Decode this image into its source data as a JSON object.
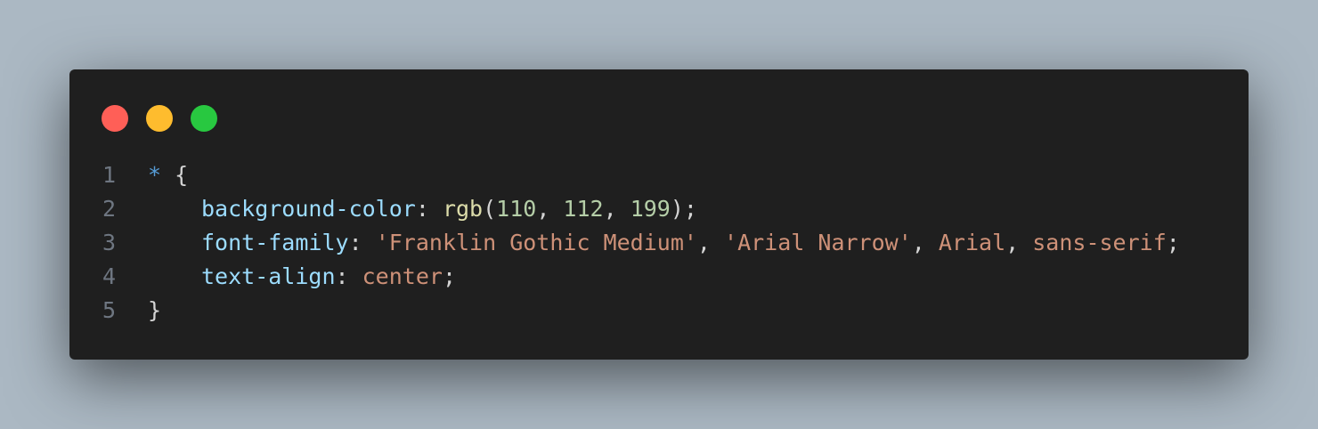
{
  "colors": {
    "background": "#abb8c3",
    "window": "#1f1f1f",
    "close": "#ff5f57",
    "minimize": "#febc2e",
    "zoom": "#28c840",
    "line_number": "#6e7681",
    "selector": "#569cd6",
    "punctuation": "#d4d4d4",
    "property": "#9cdcfe",
    "function": "#dcdcaa",
    "number": "#b5cea8",
    "string": "#ce9178"
  },
  "window_controls": {
    "close_icon": "close-dot",
    "minimize_icon": "minimize-dot",
    "zoom_icon": "zoom-dot"
  },
  "code": {
    "lines": [
      {
        "number": "1",
        "tokens": [
          {
            "text": "*",
            "kind": "selector"
          },
          {
            "text": " {",
            "kind": "punctuation"
          }
        ]
      },
      {
        "number": "2",
        "indent": true,
        "tokens": [
          {
            "text": "background-color",
            "kind": "property"
          },
          {
            "text": ": ",
            "kind": "punctuation"
          },
          {
            "text": "rgb",
            "kind": "function"
          },
          {
            "text": "(",
            "kind": "punctuation"
          },
          {
            "text": "110",
            "kind": "number"
          },
          {
            "text": ", ",
            "kind": "punctuation"
          },
          {
            "text": "112",
            "kind": "number"
          },
          {
            "text": ", ",
            "kind": "punctuation"
          },
          {
            "text": "199",
            "kind": "number"
          },
          {
            "text": ");",
            "kind": "punctuation"
          }
        ]
      },
      {
        "number": "3",
        "indent": true,
        "tokens": [
          {
            "text": "font-family",
            "kind": "property"
          },
          {
            "text": ": ",
            "kind": "punctuation"
          },
          {
            "text": "'Franklin Gothic Medium'",
            "kind": "string"
          },
          {
            "text": ", ",
            "kind": "punctuation"
          },
          {
            "text": "'Arial Narrow'",
            "kind": "string"
          },
          {
            "text": ", ",
            "kind": "punctuation"
          },
          {
            "text": "Arial",
            "kind": "string"
          },
          {
            "text": ", ",
            "kind": "punctuation"
          },
          {
            "text": "sans-serif",
            "kind": "string"
          },
          {
            "text": ";",
            "kind": "punctuation"
          }
        ]
      },
      {
        "number": "4",
        "indent": true,
        "tokens": [
          {
            "text": "text-align",
            "kind": "property"
          },
          {
            "text": ": ",
            "kind": "punctuation"
          },
          {
            "text": "center",
            "kind": "string"
          },
          {
            "text": ";",
            "kind": "punctuation"
          }
        ]
      },
      {
        "number": "5",
        "tokens": [
          {
            "text": "}",
            "kind": "punctuation"
          }
        ]
      }
    ]
  }
}
